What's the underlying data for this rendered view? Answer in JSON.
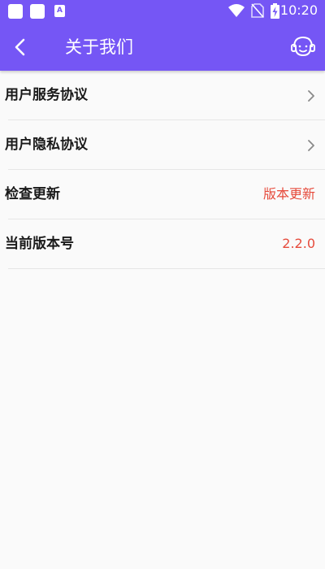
{
  "status_bar": {
    "time": "10:20",
    "notification_icons": [
      "app-icon",
      "app-icon",
      "text-a-icon"
    ],
    "text_icon_letter": "A",
    "system_icons": [
      "wifi-icon",
      "no-sim-icon",
      "battery-charging-icon"
    ]
  },
  "header": {
    "title": "关于我们",
    "back_icon": "back-arrow-icon",
    "service_icon": "customer-service-icon",
    "background_color": "#7556f5"
  },
  "settings": [
    {
      "label": "用户服务协议",
      "value": "",
      "icon": "chevron-right-icon"
    },
    {
      "label": "用户隐私协议",
      "value": "",
      "icon": "chevron-right-icon"
    },
    {
      "label": "检查更新",
      "value": "版本更新"
    },
    {
      "label": "当前版本号",
      "value": "2.2.0"
    }
  ],
  "colors": {
    "accent_value": "#e64b3c",
    "label_text": "#1a1a1a",
    "background": "#fafafa"
  }
}
